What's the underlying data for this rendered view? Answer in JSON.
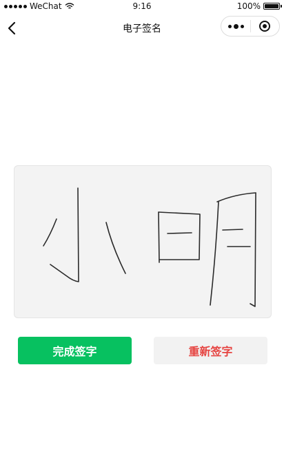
{
  "status_bar": {
    "carrier": "WeChat",
    "time": "9:16",
    "battery": "100%"
  },
  "nav": {
    "title": "电子签名"
  },
  "buttons": {
    "confirm_label": "完成签字",
    "reset_label": "重新签字"
  },
  "colors": {
    "confirm_bg": "#07c160",
    "reset_text": "#e64340",
    "pad_bg": "#f3f3f3"
  },
  "icons": [
    "signal-dots-icon",
    "wifi-icon",
    "battery-icon",
    "back-arrow-icon",
    "more-dots-icon",
    "close-target-icon"
  ]
}
